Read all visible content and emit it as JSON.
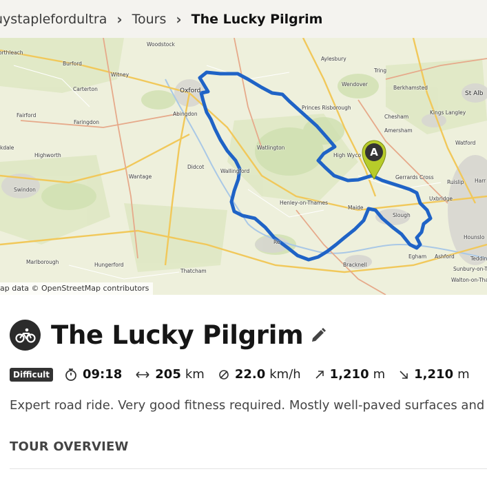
{
  "breadcrumb": {
    "user": "uystaplefordultra",
    "tours": "Tours",
    "current": "The Lucky Pilgrim"
  },
  "map": {
    "attribution": "ap data © OpenStreetMap contributors",
    "start_marker": "A",
    "route_color": "#1f63c6",
    "places": [
      "Woodstock",
      "orthleach",
      "Burford",
      "Witney",
      "Carterton",
      "Oxford",
      "Aylesbury",
      "Tring",
      "Wendover",
      "Berkhamsted",
      "St Alb",
      "Fairford",
      "Faringdon",
      "Abingdon",
      "Princes Risborough",
      "Chesham",
      "Kings Langley",
      "Amersham",
      "Watford",
      "kdale",
      "Highworth",
      "Watlington",
      "High Wyco",
      "Didcot",
      "Wallingford",
      "Gerrards Cross",
      "Ruislip",
      "Harr",
      "Swindon",
      "Wantage",
      "Uxbridge",
      "Henley-on-Thames",
      "Maide",
      "Slough",
      "Hounslo",
      "Marlborough",
      "Hungerford",
      "Re",
      "Bracknell",
      "Egham",
      "Ashford",
      "Tedding",
      "Sunbury-on-Thames",
      "Thatcham",
      "Walton-on-Thames"
    ]
  },
  "tour": {
    "sport": "road-cycling",
    "title": "The Lucky Pilgrim",
    "difficulty": "Difficult",
    "duration": "09:18",
    "distance": "205",
    "distance_unit": "km",
    "speed": "22.0",
    "speed_unit": "km/h",
    "uphill": "1,210",
    "uphill_unit": "m",
    "downhill": "1,210",
    "downhill_unit": "m",
    "description": "Expert road ride. Very good fitness required. Mostly well-paved surfaces and ea"
  },
  "sections": {
    "overview": "TOUR OVERVIEW"
  }
}
